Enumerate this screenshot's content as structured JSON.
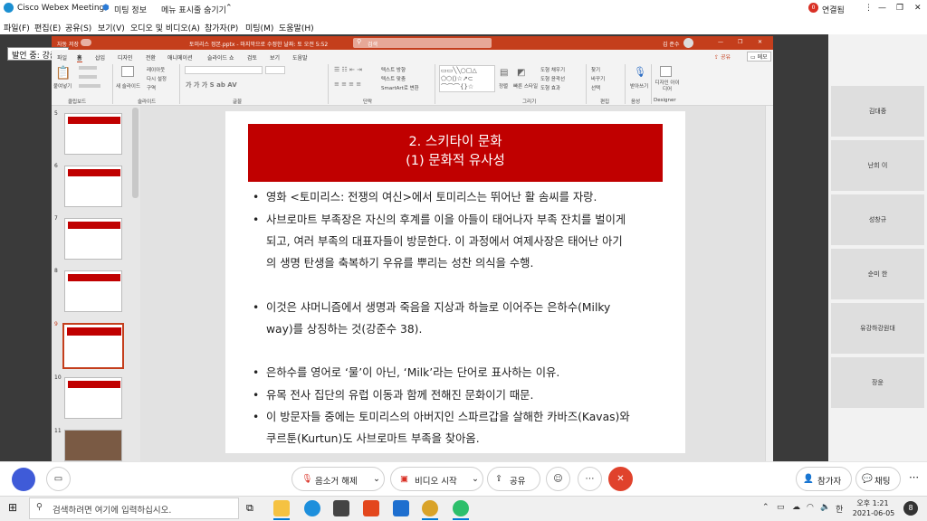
{
  "window": {
    "app_title": "Cisco Webex Meetings",
    "meeting_info": "미팅 정보",
    "hide_menu": "메뉴 표시줄 숨기기",
    "connection_status": "연결됨"
  },
  "menu": [
    "파일(F)",
    "편집(E)",
    "공유(S)",
    "보기(V)",
    "오디오 및 비디오(A)",
    "참가자(P)",
    "미팅(M)",
    "도움말(H)"
  ],
  "speaking_label": "발언 중: 강준수",
  "ppt": {
    "autosave": "자동 저장",
    "title": "토미리스 정본.pptx - 마지막으로 수정한 날짜: 토 오전 5:52",
    "search": "검색",
    "user": "김 준수",
    "tabs": [
      "파일",
      "홈",
      "삽입",
      "디자인",
      "전환",
      "애니메이션",
      "슬라이드 쇼",
      "검토",
      "보기",
      "도움말"
    ],
    "share_btn": "공유",
    "memo_btn": "메모",
    "groups": [
      "클립보드",
      "슬라이드",
      "글꼴",
      "단락",
      "그리기",
      "편집",
      "음성",
      "Designer"
    ],
    "ribbon_labels": {
      "paste": "붙여넣기",
      "new_slide": "새 슬라이드",
      "layout": "레이아웃",
      "reset": "다시 설정",
      "section": "구역",
      "text_dir": "텍스트 방향",
      "align_text": "텍스트 맞춤",
      "smartart": "SmartArt로 변환",
      "arrange": "정렬",
      "quick_styles": "빠른 스타일",
      "shape_fill": "도형 채우기",
      "shape_outline": "도형 윤곽선",
      "shape_effects": "도형 효과",
      "find": "찾기",
      "replace": "바꾸기",
      "select": "선택",
      "dictate": "받아쓰기",
      "design_ideas": "디자인 아이디어"
    }
  },
  "thumbnails": [
    {
      "num": "5"
    },
    {
      "num": "6"
    },
    {
      "num": "7"
    },
    {
      "num": "8"
    },
    {
      "num": "9",
      "selected": true
    },
    {
      "num": "10"
    },
    {
      "num": "11"
    }
  ],
  "slide": {
    "title_line1": "2. 스키타이 문화",
    "title_line2": "(1) 문화적 유사성",
    "bullets": [
      {
        "dot": "•",
        "lines": [
          "영화 <토미리스: 전쟁의 여신>에서 토미리스는 뛰어난 활 솜씨를 자랑."
        ]
      },
      {
        "dot": "•",
        "lines": [
          "사브로마트 부족장은 자신의 후계를 이을 아들이 태어나자 부족 잔치를 벌이게",
          "되고, 여러 부족의 대표자들이 방문한다. 이 과정에서 여제사장은 태어난 아기",
          "의 생명 탄생을 축복하기 우유를 뿌리는 성찬 의식을 수행."
        ]
      },
      {
        "dot": "•",
        "lines": [
          "이것은 샤머니즘에서 생명과 죽음을 지상과 하늘로 이어주는 은하수(Milky",
          "way)를 상징하는 것(강준수 38)."
        ]
      },
      {
        "dot": "•",
        "lines": [
          "은하수를 영어로 ‘물’이 아닌, ‘Milk’라는 단어로 표사하는 이유."
        ]
      },
      {
        "dot": "•",
        "lines": [
          "유목 전사 집단의 유럽 이동과 함께 전해진 문화이기 때문."
        ]
      },
      {
        "dot": "•",
        "lines": [
          "이 방문자들 중에는 토미리스의 아버지인 스파르갑을 살해한 카바즈(Kavas)와",
          "쿠르툰(Kurtun)도 사브로마트 부족을 찾아옴."
        ]
      }
    ]
  },
  "participants": [
    "김대중",
    "난희 이",
    "성창규",
    "순미 한",
    "유강하강원대",
    "장윤"
  ],
  "controls": {
    "unmute": "음소거 해제",
    "video": "비디오 시작",
    "share": "공유",
    "participants": "참가자",
    "chat": "채팅"
  },
  "taskbar": {
    "search_placeholder": "검색하려면 여기에 입력하십시오.",
    "time": "오후 1:21",
    "date": "2021-06-05",
    "ime": "한",
    "notif_count": "8"
  },
  "colors": {
    "ppt_accent": "#c43e1c",
    "slide_banner": "#c00000",
    "end_call": "#e0422c"
  }
}
